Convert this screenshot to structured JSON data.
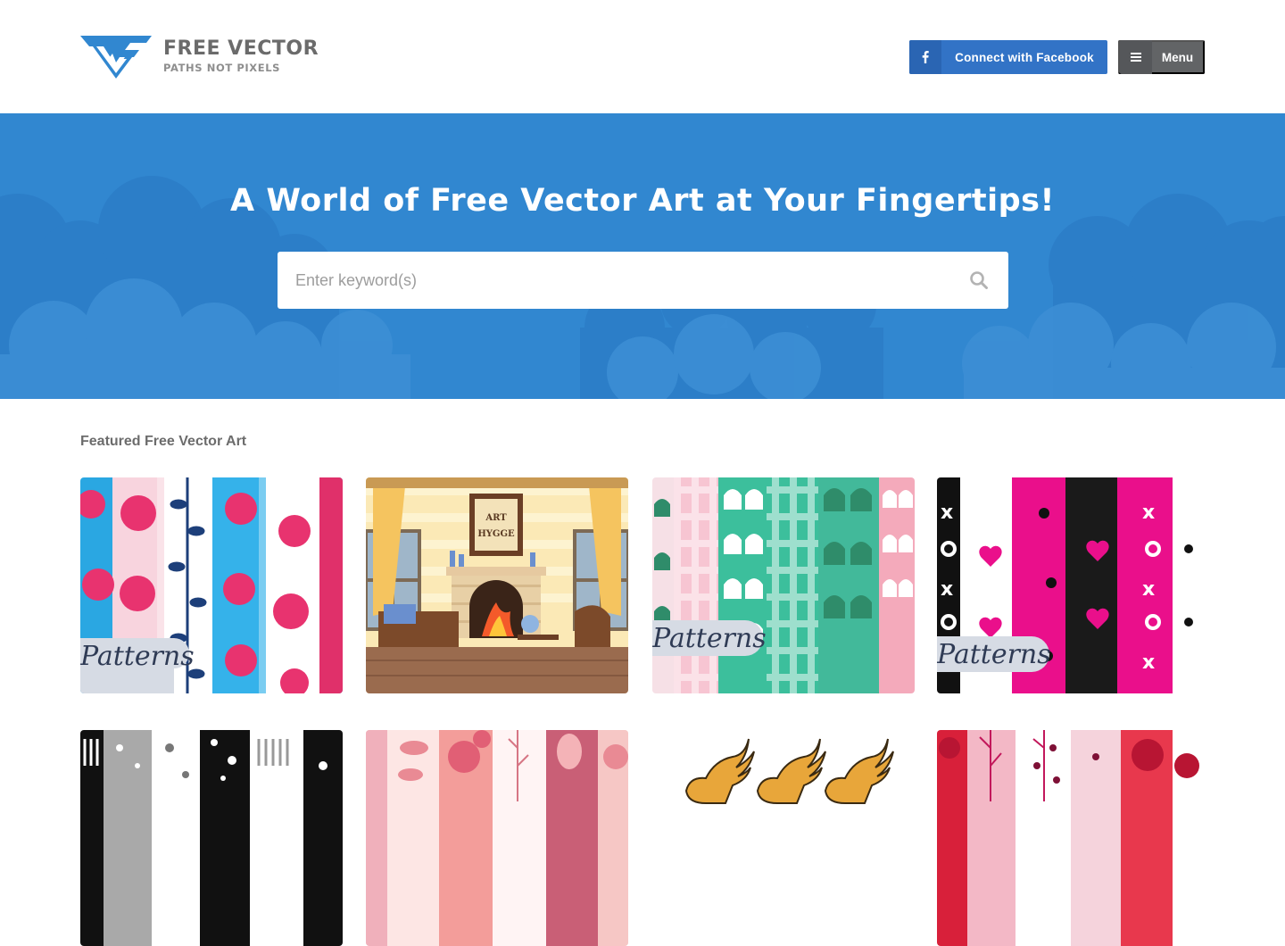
{
  "brand": {
    "title": "FREE VECTOR",
    "tagline": "PATHS NOT PIXELS",
    "logo_icon": "fv-logo-icon",
    "accent": "#3187d0"
  },
  "header": {
    "facebook_label": "Connect with Facebook",
    "facebook_icon": "facebook-icon",
    "menu_label": "Menu",
    "menu_icon": "hamburger-icon"
  },
  "hero": {
    "title": "A World of Free Vector Art at Your Fingertips!",
    "search_placeholder": "Enter keyword(s)",
    "search_value": "",
    "search_icon": "search-icon"
  },
  "featured": {
    "heading": "Featured Free Vector Art",
    "items": [
      {
        "badge": "Patterns",
        "art": "pink-flower-pattern"
      },
      {
        "badge": "",
        "art": "hygge-fireplace-room",
        "sign": "ART OF HYGGE"
      },
      {
        "badge": "Patterns",
        "art": "gingham-tulip-pattern"
      },
      {
        "badge": "Patterns",
        "art": "pink-black-hearts-pattern"
      },
      {
        "badge": "",
        "art": "black-white-dots-pattern"
      },
      {
        "badge": "",
        "art": "pink-rose-pattern"
      },
      {
        "badge": "",
        "art": "golden-griffins"
      },
      {
        "badge": "",
        "art": "red-floral-pattern"
      }
    ]
  }
}
